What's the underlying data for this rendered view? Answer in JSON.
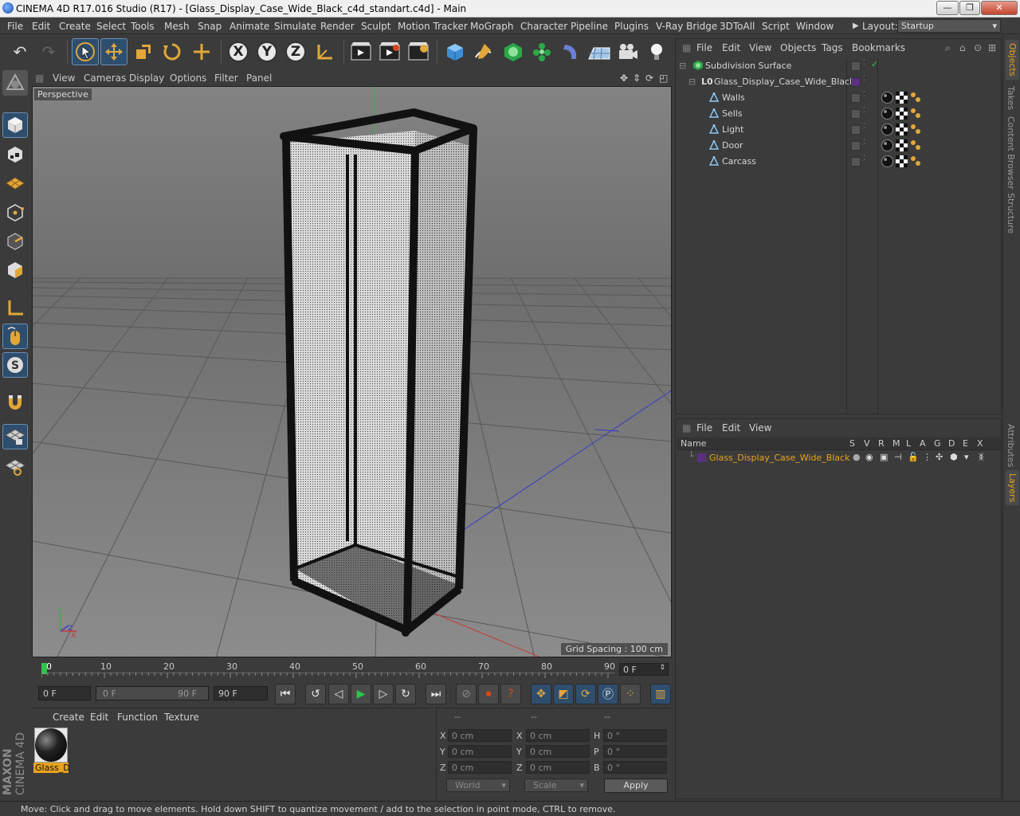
{
  "window": {
    "title": "CINEMA 4D R17.016 Studio (R17) - [Glass_Display_Case_Wide_Black_c4d_standart.c4d] - Main",
    "minimize": "—",
    "maximize": "❐",
    "close": "✕"
  },
  "menu": {
    "items": [
      "File",
      "Edit",
      "Create",
      "Select",
      "Tools",
      "Mesh",
      "Snap",
      "Animate",
      "Simulate",
      "Render",
      "Sculpt",
      "Motion Tracker",
      "MoGraph",
      "Character",
      "Pipeline",
      "Plugins",
      "V-Ray Bridge",
      "3DToAll",
      "Script",
      "Window"
    ],
    "layout_label": "Layout:",
    "layout_value": "Startup"
  },
  "toolbar": {
    "axis_x": "X",
    "axis_y": "Y",
    "axis_z": "Z"
  },
  "viewport": {
    "menu": [
      "View",
      "Cameras",
      "Display",
      "Options",
      "Filter",
      "Panel"
    ],
    "camera_label": "Perspective",
    "grid_spacing": "Grid Spacing : 100 cm"
  },
  "timeline": {
    "ticks": [
      "0",
      "10",
      "20",
      "30",
      "40",
      "50",
      "60",
      "70",
      "80",
      "90"
    ],
    "current_frame": "0 F"
  },
  "transport": {
    "start": "0 F",
    "range_start": "0 F",
    "range_end": "90 F",
    "end": "90 F"
  },
  "material_manager": {
    "menu": [
      "Create",
      "Edit",
      "Function",
      "Texture"
    ],
    "material_name": "Glass_D"
  },
  "coordinates": {
    "header": [
      "--",
      "--",
      "--"
    ],
    "pos_labels": [
      "X",
      "Y",
      "Z"
    ],
    "size_labels": [
      "X",
      "Y",
      "Z"
    ],
    "rot_labels": [
      "H",
      "P",
      "B"
    ],
    "pos": [
      "0 cm",
      "0 cm",
      "0 cm"
    ],
    "size": [
      "0 cm",
      "0 cm",
      "0 cm"
    ],
    "rot": [
      "0 °",
      "0 °",
      "0 °"
    ],
    "world": "World",
    "scale": "Scale",
    "apply": "Apply"
  },
  "status": {
    "text": "Move: Click and drag to move elements. Hold down SHIFT to quantize movement / add to the selection in point mode, CTRL to remove."
  },
  "branding": {
    "maxon": "MAXON",
    "cinema": "CINEMA 4D"
  },
  "object_manager": {
    "menu": [
      "File",
      "Edit",
      "View",
      "Objects",
      "Tags",
      "Bookmarks"
    ],
    "objects": [
      {
        "name": "Subdivision Surface"
      },
      {
        "name": "Glass_Display_Case_Wide_Black"
      },
      {
        "name": "Walls"
      },
      {
        "name": "Sells"
      },
      {
        "name": "Light"
      },
      {
        "name": "Door"
      },
      {
        "name": "Carcass"
      }
    ]
  },
  "layer_manager": {
    "menu": [
      "File",
      "Edit",
      "View"
    ],
    "columns": [
      "Name",
      "S",
      "V",
      "R",
      "M",
      "L",
      "A",
      "G",
      "D",
      "E",
      "X"
    ],
    "layer_name": "Glass_Display_Case_Wide_Black"
  },
  "right_tabs": [
    "Objects",
    "Takes",
    "Content Browser",
    "Structure",
    "Attributes",
    "Layers"
  ],
  "colors": {
    "accent": "#e8a21e",
    "selection": "#2f4e6e",
    "panel": "#3b3b3b"
  }
}
